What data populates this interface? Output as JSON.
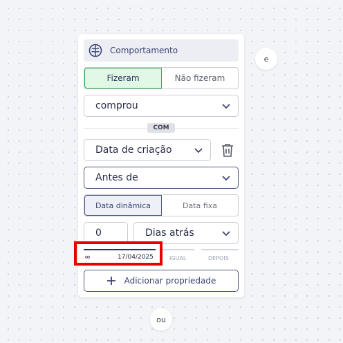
{
  "card": {
    "header_title": "Comportamento",
    "header_icon": "brain-icon",
    "toggle_did": {
      "active": "Fizeram",
      "inactive": "Não fizeram"
    },
    "event_select": "comprou",
    "with_badge": "COM",
    "property_select": "Data de criação",
    "operator_select": "Antes de",
    "date_mode": {
      "active": "Data dinâmica",
      "inactive": "Data fixa"
    },
    "number_value": "0",
    "unit_select": "Dias atrás",
    "range": {
      "start_symbol": "∞",
      "date": "17/04/2025",
      "equal_label": "IGUAL",
      "after_label": "DEPOIS"
    },
    "add_property": "Adicionar propriedade"
  },
  "connectors": {
    "and": "e",
    "or": "ou"
  },
  "colors": {
    "accent": "#3a4272",
    "active_green_bg": "#e2f8e6",
    "active_green_border": "#2fae50",
    "highlight": "#e60000"
  }
}
